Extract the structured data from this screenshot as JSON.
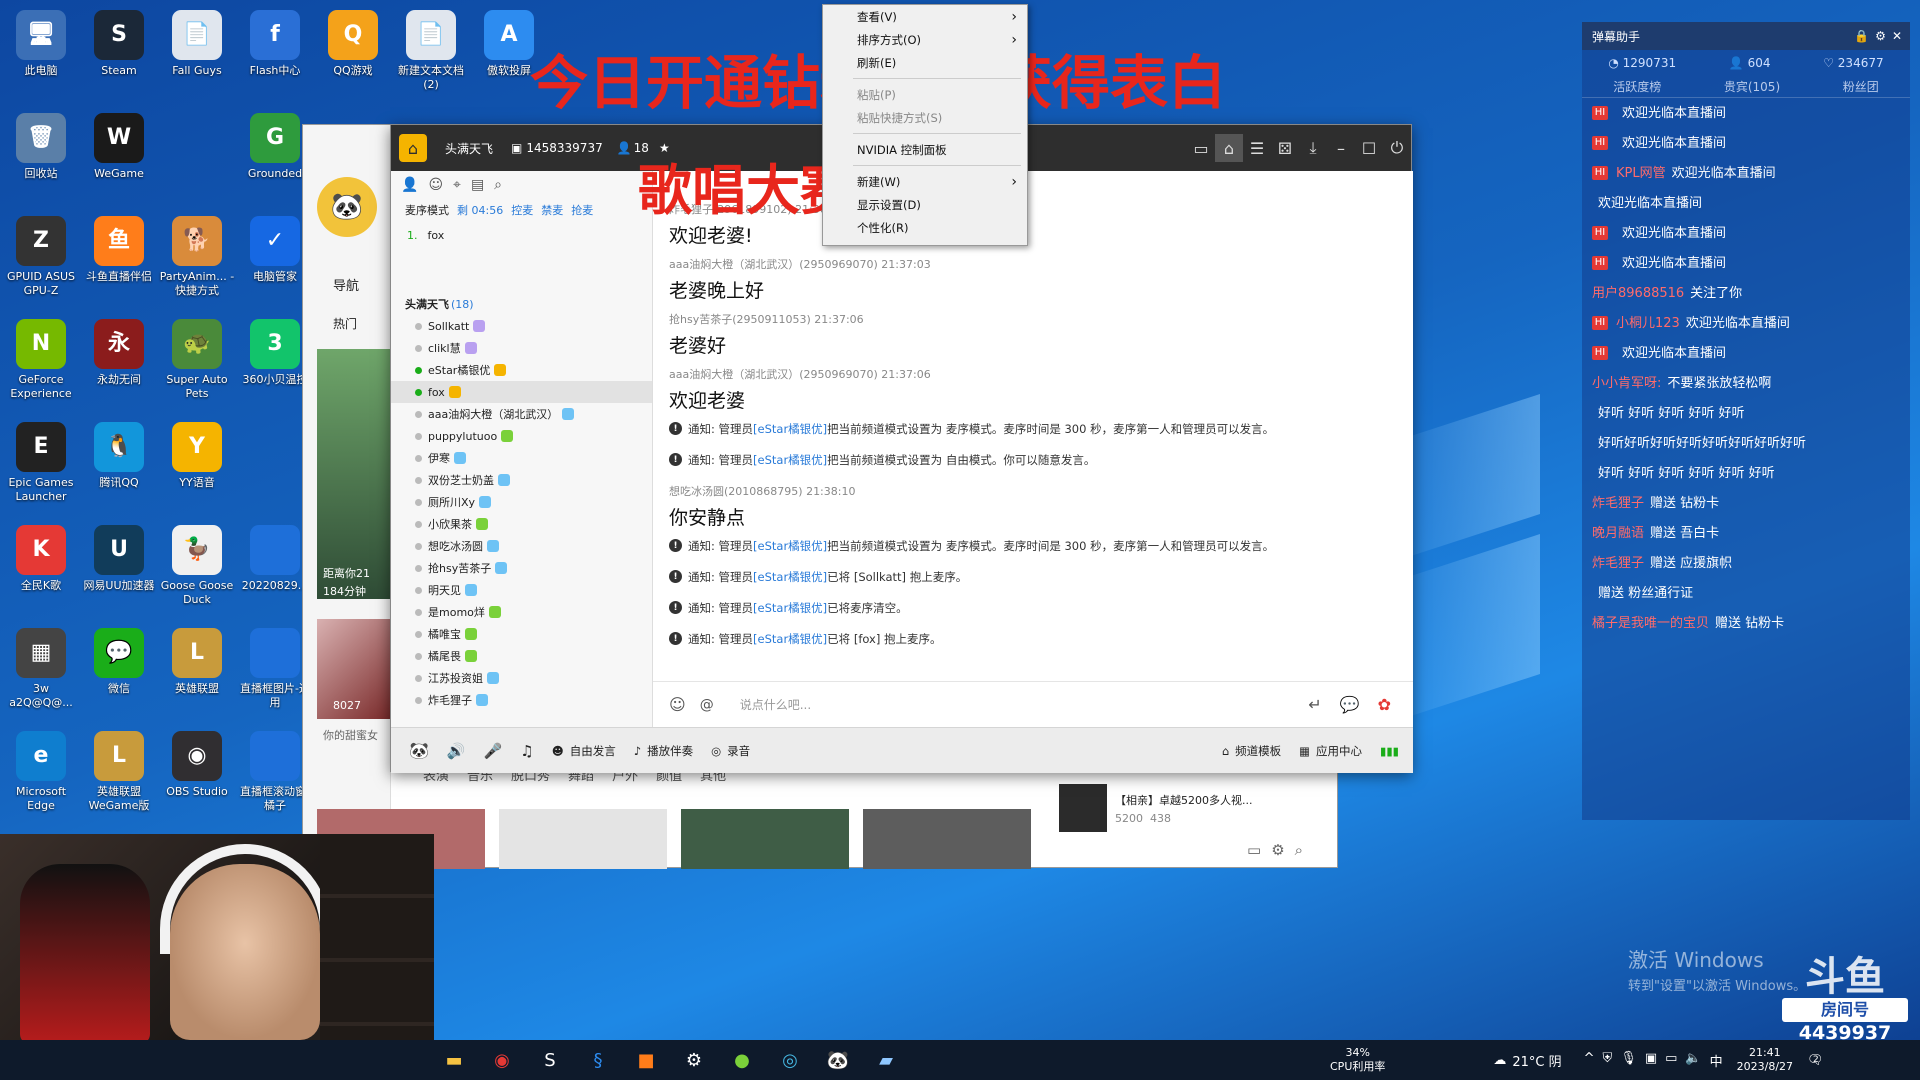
{
  "desktop_icons": [
    {
      "label": "此电脑",
      "glyph": "🖥",
      "bg": "#3b6fb6"
    },
    {
      "label": "Steam",
      "glyph": "S",
      "bg": "#1b2838"
    },
    {
      "label": "Fall Guys",
      "glyph": "📄",
      "bg": "#e0e6ee"
    },
    {
      "label": "Flash中心",
      "glyph": "f",
      "bg": "#2a6fd6"
    },
    {
      "label": "QQ游戏",
      "glyph": "Q",
      "bg": "#f4a21a"
    },
    {
      "label": "新建文本文档(2)",
      "glyph": "📄",
      "bg": "#e0e6ee"
    },
    {
      "label": "傲软投屏",
      "glyph": "A",
      "bg": "#2d8cf0"
    },
    {
      "label": "回收站",
      "glyph": "🗑",
      "bg": "#5a7fa8"
    },
    {
      "label": "WeGame",
      "glyph": "W",
      "bg": "#1a1a1a"
    },
    {
      "label": "Grounded",
      "glyph": "G",
      "bg": "#2e9b3d"
    },
    {
      "label": "GPUID ASUS GPU-Z",
      "glyph": "Z",
      "bg": "#333"
    },
    {
      "label": "斗鱼直播伴侣",
      "glyph": "鱼",
      "bg": "#ff7d1a"
    },
    {
      "label": "PartyAnim... - 快捷方式",
      "glyph": "🐕",
      "bg": "#d98b3b"
    },
    {
      "label": "电脑管家",
      "glyph": "✓",
      "bg": "#1668e3"
    },
    {
      "label": "GeForce Experience",
      "glyph": "N",
      "bg": "#76b900"
    },
    {
      "label": "永劫无间",
      "glyph": "永",
      "bg": "#8b1c1c"
    },
    {
      "label": "Super Auto Pets",
      "glyph": "🐢",
      "bg": "#4a8a3a"
    },
    {
      "label": "360小贝温控",
      "glyph": "3",
      "bg": "#12c46b"
    },
    {
      "label": "Epic Games Launcher",
      "glyph": "E",
      "bg": "#222"
    },
    {
      "label": "腾讯QQ",
      "glyph": "🐧",
      "bg": "#1296db"
    },
    {
      "label": "YY语音",
      "glyph": "Y",
      "bg": "#f5b400"
    },
    {
      "label": "全民K歌",
      "glyph": "K",
      "bg": "#e53935"
    },
    {
      "label": "网易UU加速器",
      "glyph": "U",
      "bg": "#113c5a"
    },
    {
      "label": "Goose Goose Duck",
      "glyph": "🦆",
      "bg": "#f0f0f0"
    },
    {
      "label": "20220829...",
      "glyph": "",
      "bg": "#1e6fd9"
    },
    {
      "label": "3w a2Q@Q@...",
      "glyph": "▦",
      "bg": "#444"
    },
    {
      "label": "微信",
      "glyph": "💬",
      "bg": "#1aad19"
    },
    {
      "label": "英雄联盟",
      "glyph": "L",
      "bg": "#c89b3c"
    },
    {
      "label": "直播框图片-通用",
      "glyph": "",
      "bg": "#1e6fd9"
    },
    {
      "label": "Microsoft Edge",
      "glyph": "e",
      "bg": "#0f7ecf"
    },
    {
      "label": "英雄联盟WeGame版",
      "glyph": "L",
      "bg": "#c89b3c"
    },
    {
      "label": "OBS Studio",
      "glyph": "◉",
      "bg": "#302e31"
    },
    {
      "label": "直播框滚动窗-橘子",
      "glyph": "",
      "bg": "#1e6fd9"
    }
  ],
  "banners": {
    "top": "今日开通钻粉可以获得表白",
    "middle": "歌唱大赛总决赛"
  },
  "context_menu": {
    "items": [
      {
        "label": "查看(V)",
        "sub": true,
        "disabled": false
      },
      {
        "label": "排序方式(O)",
        "sub": true,
        "disabled": false
      },
      {
        "label": "刷新(E)",
        "sub": false,
        "disabled": false
      },
      {
        "label": "粘贴(P)",
        "sub": false,
        "disabled": true
      },
      {
        "label": "粘贴快捷方式(S)",
        "sub": false,
        "disabled": true
      },
      {
        "label": "NVIDIA 控制面板",
        "sub": false,
        "disabled": false
      },
      {
        "label": "新建(W)",
        "sub": true,
        "disabled": false
      },
      {
        "label": "显示设置(D)",
        "sub": false,
        "disabled": false
      },
      {
        "label": "个性化(R)",
        "sub": false,
        "disabled": false
      }
    ]
  },
  "yy": {
    "channel_name": "头满天飞",
    "channel_id": "1458339737",
    "online": "18",
    "mode_label": "麦序模式",
    "timer": "剩 04:56",
    "mode_actions": [
      "控麦",
      "禁麦",
      "抢麦"
    ],
    "queue": [
      {
        "index": "1.",
        "name": "fox"
      }
    ],
    "group_title": "头满天飞",
    "group_count": "(18)",
    "members": [
      "Sollkatt",
      "clikl慧",
      "eStar橘银优",
      "fox",
      "aaa油焖大橙（湖北武汉）",
      "puppylutuoo",
      "伊寒",
      "双份芝士奶盖",
      "厕所川Xy",
      "小欣果茶",
      "想吃冰汤圆",
      "抢hsy苦茶子",
      "明天见",
      "是momo烊",
      "橘唯宝",
      "橘尾畏",
      "江苏投资姐",
      "炸毛狸子"
    ],
    "messages": [
      {
        "type": "msg",
        "meta": "炸毛狸子(2961899102) 21:36:43",
        "body": "欢迎老婆!"
      },
      {
        "type": "msg",
        "meta": "aaa油焖大橙（湖北武汉）(2950969070) 21:37:03",
        "body": "老婆晚上好"
      },
      {
        "type": "msg",
        "meta": "抢hsy苦茶子(2950911053) 21:37:06",
        "body": "老婆好"
      },
      {
        "type": "msg",
        "meta": "aaa油焖大橙（湖北武汉）(2950969070) 21:37:06",
        "body": "欢迎老婆"
      },
      {
        "type": "notice",
        "pre": "通知: 管理员 ",
        "hl": "[eStar橘银优]",
        "post": " 把当前频道模式设置为 麦序模式。麦序时间是 300 秒，麦序第一人和管理员可以发言。"
      },
      {
        "type": "notice",
        "pre": "通知: 管理员 ",
        "hl": "[eStar橘银优]",
        "post": " 把当前频道模式设置为 自由模式。你可以随意发言。"
      },
      {
        "type": "msg",
        "meta": "想吃冰汤圆(2010868795) 21:38:10",
        "body": "你安静点"
      },
      {
        "type": "notice",
        "pre": "通知: 管理员 ",
        "hl": "[eStar橘银优]",
        "post": " 把当前频道模式设置为 麦序模式。麦序时间是 300 秒，麦序第一人和管理员可以发言。"
      },
      {
        "type": "notice",
        "pre": "通知: 管理员 ",
        "hl": "[eStar橘银优]",
        "post": " 已将 [Sollkatt] 抱上麦序。"
      },
      {
        "type": "notice",
        "pre": "通知: 管理员 ",
        "hl": "[eStar橘银优]",
        "post": " 已将麦序清空。"
      },
      {
        "type": "notice",
        "pre": "通知: 管理员 ",
        "hl": "[eStar橘银优]",
        "post": " 已将 [fox] 抱上麦序。"
      }
    ],
    "input_placeholder": "说点什么吧...",
    "bottom": {
      "free_speech": "自由发言",
      "play_music": "播放伴奏",
      "record": "录音",
      "template": "频道模板",
      "app_center": "应用中心"
    },
    "nav_label": "导航",
    "hot_label": "热门"
  },
  "bgpage": {
    "categories": [
      "表演",
      "音乐",
      "脱口秀",
      "舞蹈",
      "户外",
      "颜值",
      "其他"
    ],
    "distance": "距离你21",
    "minutes": "184分钟",
    "fans": "8027",
    "caption": "你的甜蜜女",
    "promo_title": "【相亲】卓越5200多人视...",
    "promo_a": "5200",
    "promo_b": "438"
  },
  "danmaku": {
    "title": "弹幕助手",
    "stats": [
      "1290731",
      "604",
      "234677"
    ],
    "tabs": [
      "活跃度榜",
      "贵宾(105)",
      "粉丝团"
    ],
    "lines": [
      {
        "user": "",
        "text": "欢迎光临本直播间",
        "hi": true
      },
      {
        "user": "",
        "text": "欢迎光临本直播间",
        "hi": true
      },
      {
        "user": "KPL网管",
        "text": "欢迎光临本直播间",
        "hi": true
      },
      {
        "user": "",
        "text": "欢迎光临本直播间",
        "hi": false
      },
      {
        "user": "",
        "text": "欢迎光临本直播间",
        "hi": true
      },
      {
        "user": "",
        "text": "欢迎光临本直播间",
        "hi": true
      },
      {
        "user": "用户89688516",
        "text": "关注了你",
        "hi": false
      },
      {
        "user": "小桐儿123",
        "text": "欢迎光临本直播间",
        "hi": true
      },
      {
        "user": "",
        "text": "欢迎光临本直播间",
        "hi": true
      },
      {
        "user": "小小肯军呀:",
        "text": "不要紧张放轻松啊",
        "hi": false
      },
      {
        "user": "",
        "text": "好听 好听 好听 好听 好听",
        "hi": false
      },
      {
        "user": "",
        "text": "好听好听好听好听好听好听好听好听",
        "hi": false
      },
      {
        "user": "",
        "text": "好听 好听 好听 好听 好听 好听",
        "hi": false
      },
      {
        "user": "炸毛狸子",
        "text": "赠送 钻粉卡",
        "hi": false
      },
      {
        "user": "晚月融语",
        "text": "赠送 吾白卡",
        "hi": false
      },
      {
        "user": "炸毛狸子",
        "text": "赠送 应援旗帜",
        "hi": false
      },
      {
        "user": "",
        "text": "赠送 粉丝通行证",
        "hi": false
      },
      {
        "user": "橘子是我唯一的宝贝",
        "text": "赠送 钻粉卡",
        "hi": false
      }
    ]
  },
  "watermark": {
    "activate": "激活 Windows",
    "activate_sub": "转到\"设置\"以激活 Windows。",
    "room_label": "房间号",
    "room_no": "4439937"
  },
  "taskbar": {
    "cpu": "34%",
    "cpu_label": "CPU利用率",
    "weather": "21°C 阴",
    "ime": "中",
    "time": "21:41",
    "date": "2023/8/27",
    "notif": "2"
  },
  "colors": {
    "banner_red": "#e8261c",
    "link_blue": "#2a7bd8",
    "titlebar": "#2e2e2e"
  }
}
